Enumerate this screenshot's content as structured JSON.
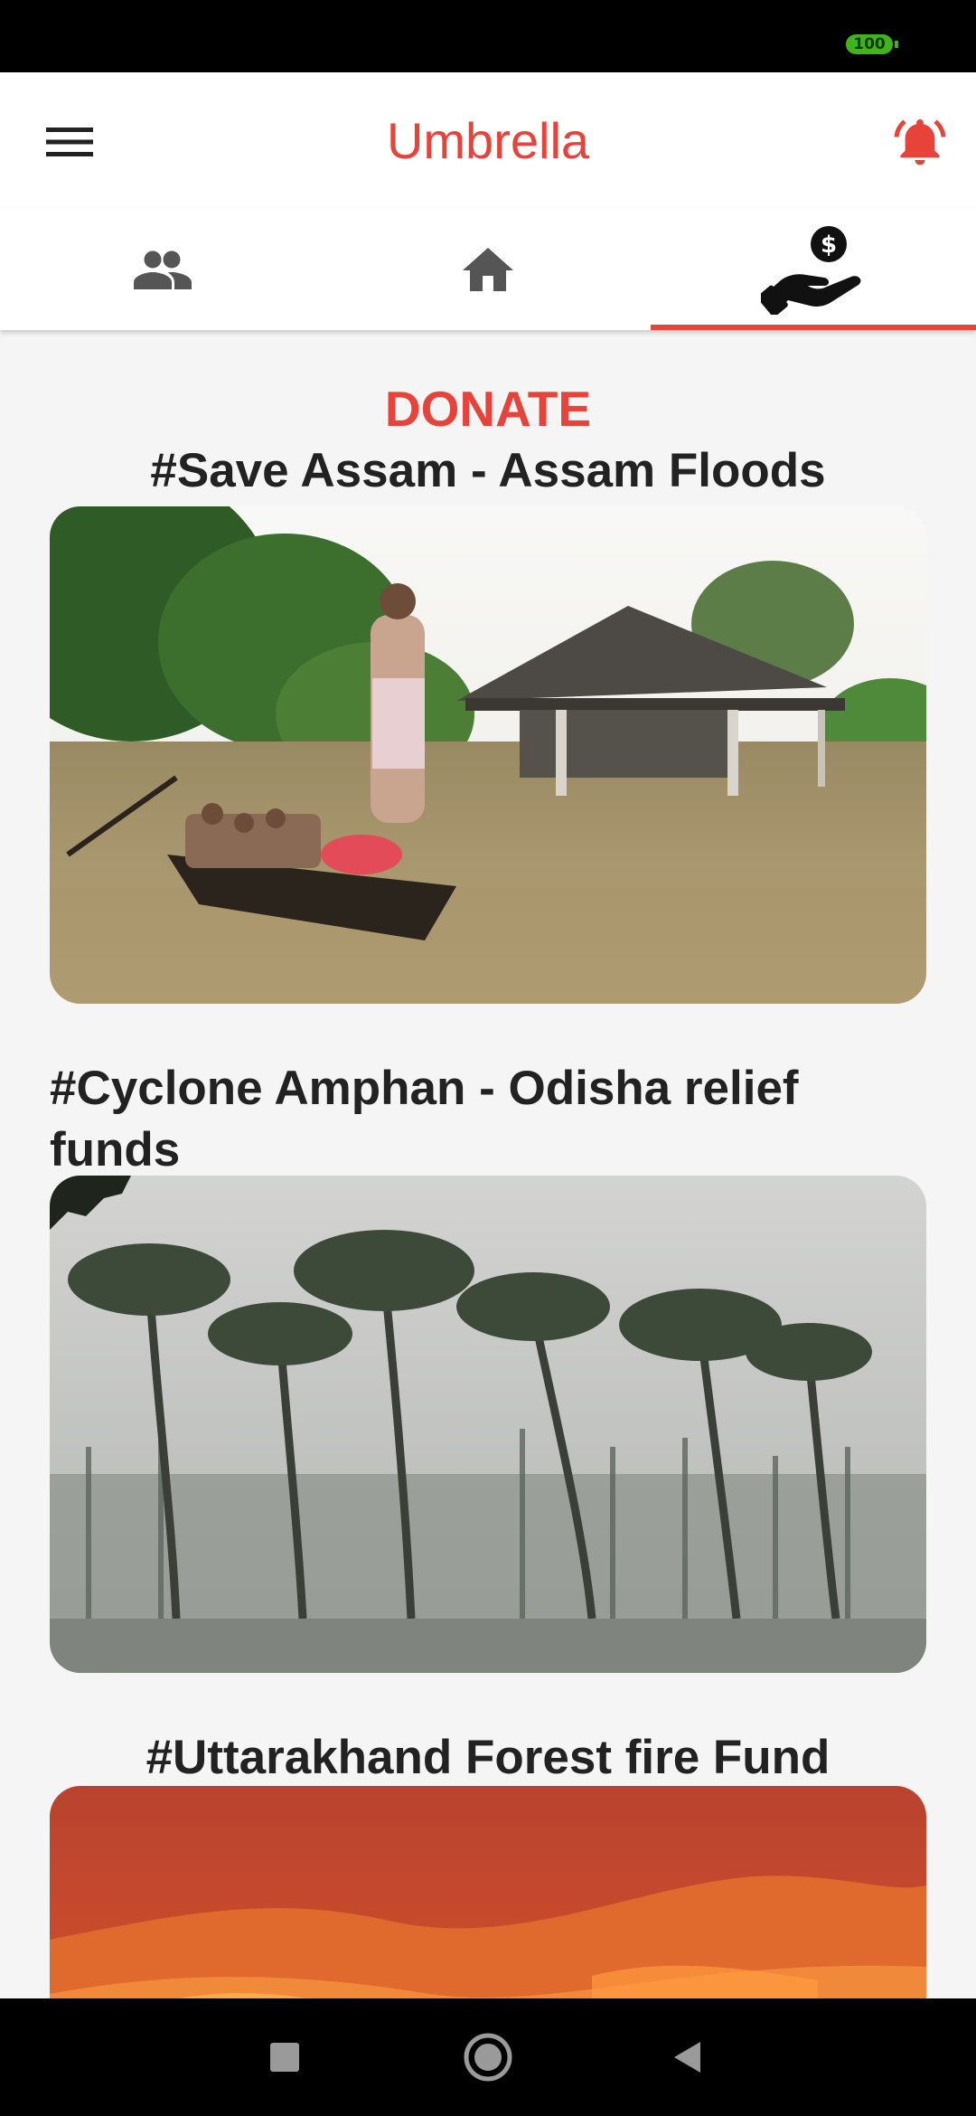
{
  "status_bar": {
    "battery": "100"
  },
  "app_bar": {
    "title": "Umbrella",
    "menu_icon": "hamburger-menu-icon",
    "bell_icon": "bell-alert-icon"
  },
  "tabs": [
    {
      "name": "people",
      "icon": "people-icon",
      "selected": false
    },
    {
      "name": "home",
      "icon": "home-icon",
      "selected": false
    },
    {
      "name": "donate",
      "icon": "donate-hand-icon",
      "selected": true
    }
  ],
  "colors": {
    "accent": "#e8433a",
    "text": "#222222",
    "icon_gray": "#555555",
    "background": "#f5f5f5"
  },
  "page": {
    "heading": "DONATE",
    "funds": [
      {
        "title": "#Save Assam - Assam Floods"
      },
      {
        "title": "#Cyclone Amphan - Odisha relief funds"
      },
      {
        "title": "#Uttarakhand Forest fire Fund"
      }
    ]
  },
  "nav_bar": {
    "recents_icon": "square-recents-icon",
    "home_icon": "circle-home-icon",
    "back_icon": "triangle-back-icon"
  }
}
